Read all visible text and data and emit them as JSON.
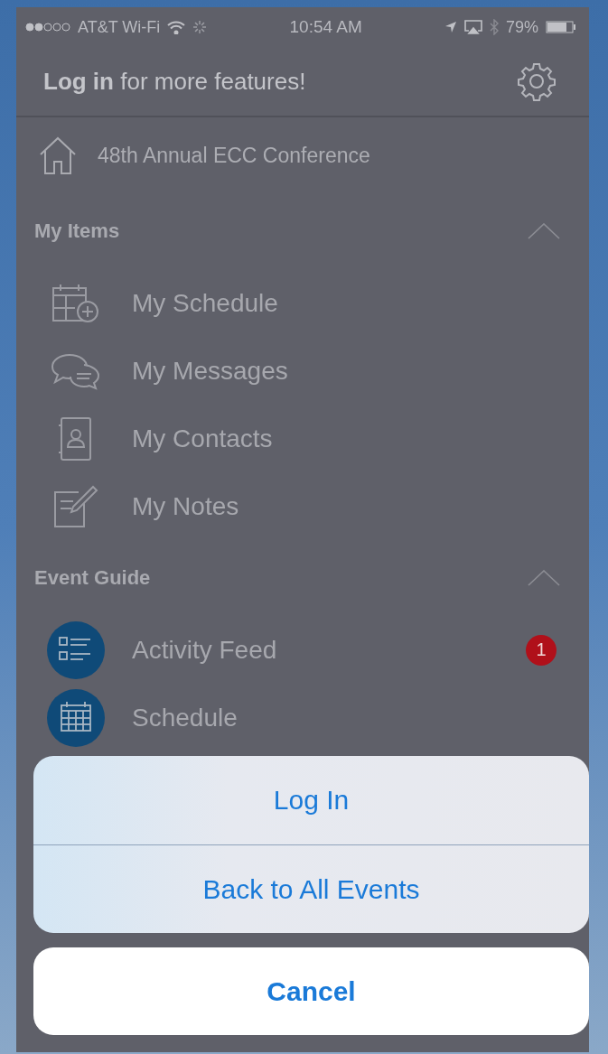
{
  "status_bar": {
    "carrier": "AT&T Wi-Fi",
    "time": "10:54 AM",
    "battery": "79%"
  },
  "header": {
    "prompt": "**Log in** for more features!"
  },
  "home": {
    "label": "48th Annual ECC Conference"
  },
  "sections": [
    {
      "title": "My Items",
      "expanded": true,
      "items": [
        {
          "label": "My Schedule",
          "kind": "outline"
        },
        {
          "label": "My Messages",
          "kind": "outline"
        },
        {
          "label": "My Contacts",
          "kind": "outline"
        },
        {
          "label": "My Notes",
          "kind": "outline"
        }
      ]
    },
    {
      "title": "Event Guide",
      "expanded": true,
      "items": [
        {
          "label": "Activity Feed",
          "kind": "circle",
          "badge": "1"
        },
        {
          "label": "Schedule",
          "kind": "circle"
        }
      ]
    }
  ],
  "action_sheet": {
    "actions": [
      "Log In",
      "Back to All Events"
    ],
    "cancel": "Cancel"
  }
}
